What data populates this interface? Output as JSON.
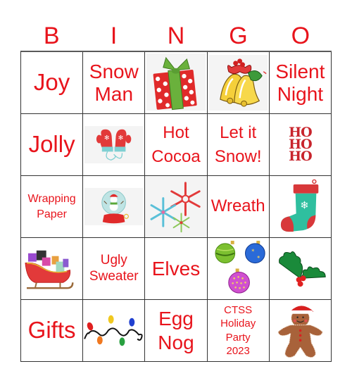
{
  "header": {
    "letters": [
      "B",
      "I",
      "N",
      "G",
      "O"
    ]
  },
  "colors": {
    "text_red": "#e8141c",
    "grid_line": "#333333"
  },
  "cells": [
    {
      "type": "text",
      "label": "Joy"
    },
    {
      "type": "text",
      "label": "Snow Man"
    },
    {
      "type": "image",
      "icon": "gift-icon"
    },
    {
      "type": "image",
      "icon": "bells-icon"
    },
    {
      "type": "text",
      "label": "Silent Night"
    },
    {
      "type": "text",
      "label": "Jolly"
    },
    {
      "type": "image",
      "icon": "mittens-icon"
    },
    {
      "type": "text",
      "label": "Hot Cocoa"
    },
    {
      "type": "text",
      "label": "Let it Snow!"
    },
    {
      "type": "image",
      "icon": "ho-ho-ho-icon",
      "text": [
        "HO",
        "HO",
        "HO"
      ]
    },
    {
      "type": "text",
      "label": "Wrapping Paper"
    },
    {
      "type": "image",
      "icon": "snow-globe-icon"
    },
    {
      "type": "image",
      "icon": "snowflakes-icon"
    },
    {
      "type": "text",
      "label": "Wreath"
    },
    {
      "type": "image",
      "icon": "stocking-icon"
    },
    {
      "type": "image",
      "icon": "sleigh-icon"
    },
    {
      "type": "text",
      "label": "Ugly Sweater"
    },
    {
      "type": "text",
      "label": "Elves"
    },
    {
      "type": "image",
      "icon": "ornaments-icon"
    },
    {
      "type": "image",
      "icon": "holly-icon"
    },
    {
      "type": "text",
      "label": "Gifts"
    },
    {
      "type": "image",
      "icon": "christmas-lights-icon"
    },
    {
      "type": "text",
      "label": "Egg Nog"
    },
    {
      "type": "text",
      "label": "CTSS Holiday Party 2023"
    },
    {
      "type": "image",
      "icon": "gingerbread-man-icon"
    }
  ]
}
